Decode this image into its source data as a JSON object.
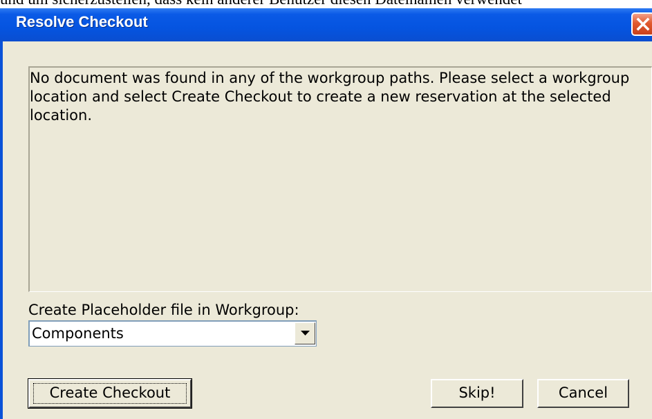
{
  "background_text": "und um sicherzustellen, dass kein anderer Benutzer diesen Dateinamen verwendet",
  "dialog": {
    "title": "Resolve Checkout",
    "message": "No document was found in any of the workgroup paths.  Please select a workgroup location and select Create Checkout to create a new reservation at the selected location.",
    "workgroup_label": "Create Placeholder file in Workgroup:",
    "workgroup_selected": "Components",
    "buttons": {
      "create_checkout": "Create Checkout",
      "skip": "Skip!",
      "cancel": "Cancel"
    }
  },
  "colors": {
    "titlebar": "#0554e0",
    "dialog_face": "#ece9d8",
    "close_button": "#e15a2e"
  }
}
